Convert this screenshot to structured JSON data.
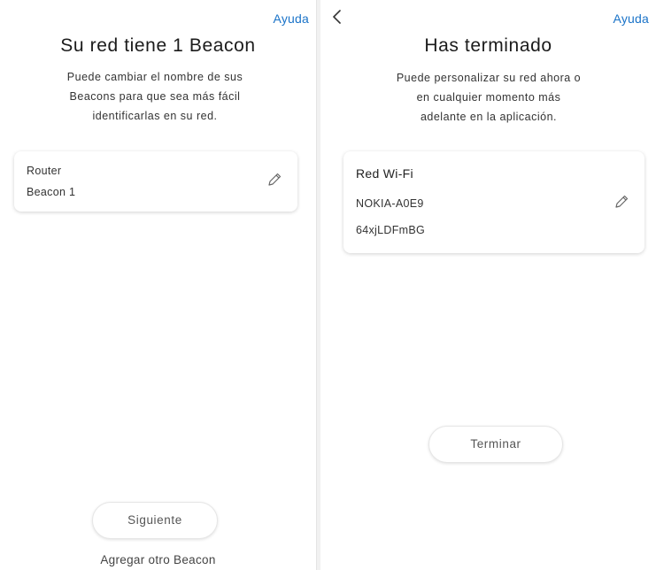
{
  "left_screen": {
    "help_label": "Ayuda",
    "title": "Su red tiene 1 Beacon",
    "subtitle_lines": [
      "Puede cambiar el nombre de sus",
      "Beacons para que sea más fácil",
      "identificarlas en su red."
    ],
    "card": {
      "line1": "Router",
      "line2": "Beacon 1",
      "edit_icon": "pencil-icon"
    },
    "next_button_label": "Siguiente",
    "add_beacon_label": "Agregar otro Beacon"
  },
  "right_screen": {
    "back_icon": "chevron-left-icon",
    "help_label": "Ayuda",
    "title": "Has terminado",
    "subtitle_lines": [
      "Puede personalizar su red ahora o",
      "en cualquier momento más",
      "adelante en la aplicación."
    ],
    "card": {
      "header": "Red Wi-Fi",
      "network_name": "NOKIA-A0E9",
      "password": "64xjLDFmBG",
      "edit_icon": "pencil-icon"
    },
    "finish_button_label": "Terminar"
  },
  "colors": {
    "accent": "#1a73c8",
    "text": "#222222",
    "card_bg": "#ffffff"
  }
}
